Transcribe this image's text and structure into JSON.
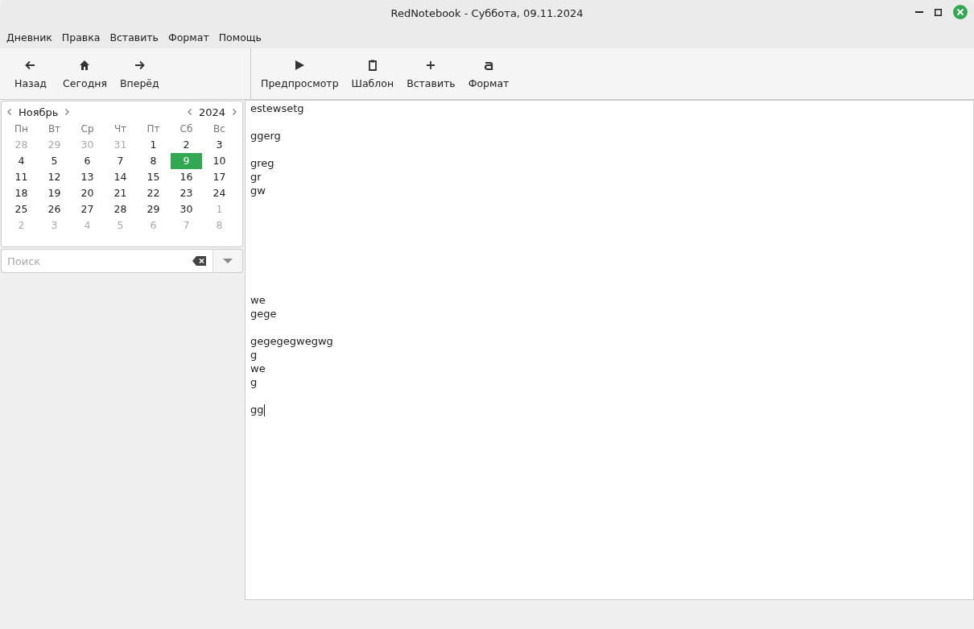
{
  "window": {
    "title": "RedNotebook - Суббота, 09.11.2024"
  },
  "menu": [
    "Дневник",
    "Правка",
    "Вставить",
    "Формат",
    "Помощь"
  ],
  "nav_toolbar": [
    {
      "kind": "back",
      "label": "Назад"
    },
    {
      "kind": "home",
      "label": "Сегодня"
    },
    {
      "kind": "forward",
      "label": "Вперёд"
    }
  ],
  "edit_toolbar": [
    {
      "kind": "play",
      "label": "Предпросмотр"
    },
    {
      "kind": "clipboard",
      "label": "Шаблон"
    },
    {
      "kind": "plus",
      "label": "Вставить"
    },
    {
      "kind": "format",
      "label": "Формат"
    }
  ],
  "calendar": {
    "month": "Ноябрь",
    "year": "2024",
    "weekdays": [
      "Пн",
      "Вт",
      "Ср",
      "Чт",
      "Пт",
      "Сб",
      "Вс"
    ],
    "weeks": [
      [
        {
          "day": "28",
          "other_month": true,
          "selected": false
        },
        {
          "day": "29",
          "other_month": true,
          "selected": false
        },
        {
          "day": "30",
          "other_month": true,
          "selected": false
        },
        {
          "day": "31",
          "other_month": true,
          "selected": false
        },
        {
          "day": "1",
          "other_month": false,
          "selected": false
        },
        {
          "day": "2",
          "other_month": false,
          "selected": false
        },
        {
          "day": "3",
          "other_month": false,
          "selected": false
        }
      ],
      [
        {
          "day": "4",
          "other_month": false,
          "selected": false
        },
        {
          "day": "5",
          "other_month": false,
          "selected": false
        },
        {
          "day": "6",
          "other_month": false,
          "selected": false
        },
        {
          "day": "7",
          "other_month": false,
          "selected": false
        },
        {
          "day": "8",
          "other_month": false,
          "selected": false
        },
        {
          "day": "9",
          "other_month": false,
          "selected": true
        },
        {
          "day": "10",
          "other_month": false,
          "selected": false
        }
      ],
      [
        {
          "day": "11",
          "other_month": false,
          "selected": false
        },
        {
          "day": "12",
          "other_month": false,
          "selected": false
        },
        {
          "day": "13",
          "other_month": false,
          "selected": false
        },
        {
          "day": "14",
          "other_month": false,
          "selected": false
        },
        {
          "day": "15",
          "other_month": false,
          "selected": false
        },
        {
          "day": "16",
          "other_month": false,
          "selected": false
        },
        {
          "day": "17",
          "other_month": false,
          "selected": false
        }
      ],
      [
        {
          "day": "18",
          "other_month": false,
          "selected": false
        },
        {
          "day": "19",
          "other_month": false,
          "selected": false
        },
        {
          "day": "20",
          "other_month": false,
          "selected": false
        },
        {
          "day": "21",
          "other_month": false,
          "selected": false
        },
        {
          "day": "22",
          "other_month": false,
          "selected": false
        },
        {
          "day": "23",
          "other_month": false,
          "selected": false
        },
        {
          "day": "24",
          "other_month": false,
          "selected": false
        }
      ],
      [
        {
          "day": "25",
          "other_month": false,
          "selected": false
        },
        {
          "day": "26",
          "other_month": false,
          "selected": false
        },
        {
          "day": "27",
          "other_month": false,
          "selected": false
        },
        {
          "day": "28",
          "other_month": false,
          "selected": false
        },
        {
          "day": "29",
          "other_month": false,
          "selected": false
        },
        {
          "day": "30",
          "other_month": false,
          "selected": false
        },
        {
          "day": "1",
          "other_month": true,
          "selected": false
        }
      ],
      [
        {
          "day": "2",
          "other_month": true,
          "selected": false
        },
        {
          "day": "3",
          "other_month": true,
          "selected": false
        },
        {
          "day": "4",
          "other_month": true,
          "selected": false
        },
        {
          "day": "5",
          "other_month": true,
          "selected": false
        },
        {
          "day": "6",
          "other_month": true,
          "selected": false
        },
        {
          "day": "7",
          "other_month": true,
          "selected": false
        },
        {
          "day": "8",
          "other_month": true,
          "selected": false
        }
      ]
    ]
  },
  "search": {
    "placeholder": "Поиск"
  },
  "editor": {
    "text": "estewsetg\n\nggerg\n\ngreg\ngr\ngw\n\n\n\n\n\n\n\nwe\ngege\n\ngegegegwegwg\ng\nwe\ng\n\ngg"
  }
}
